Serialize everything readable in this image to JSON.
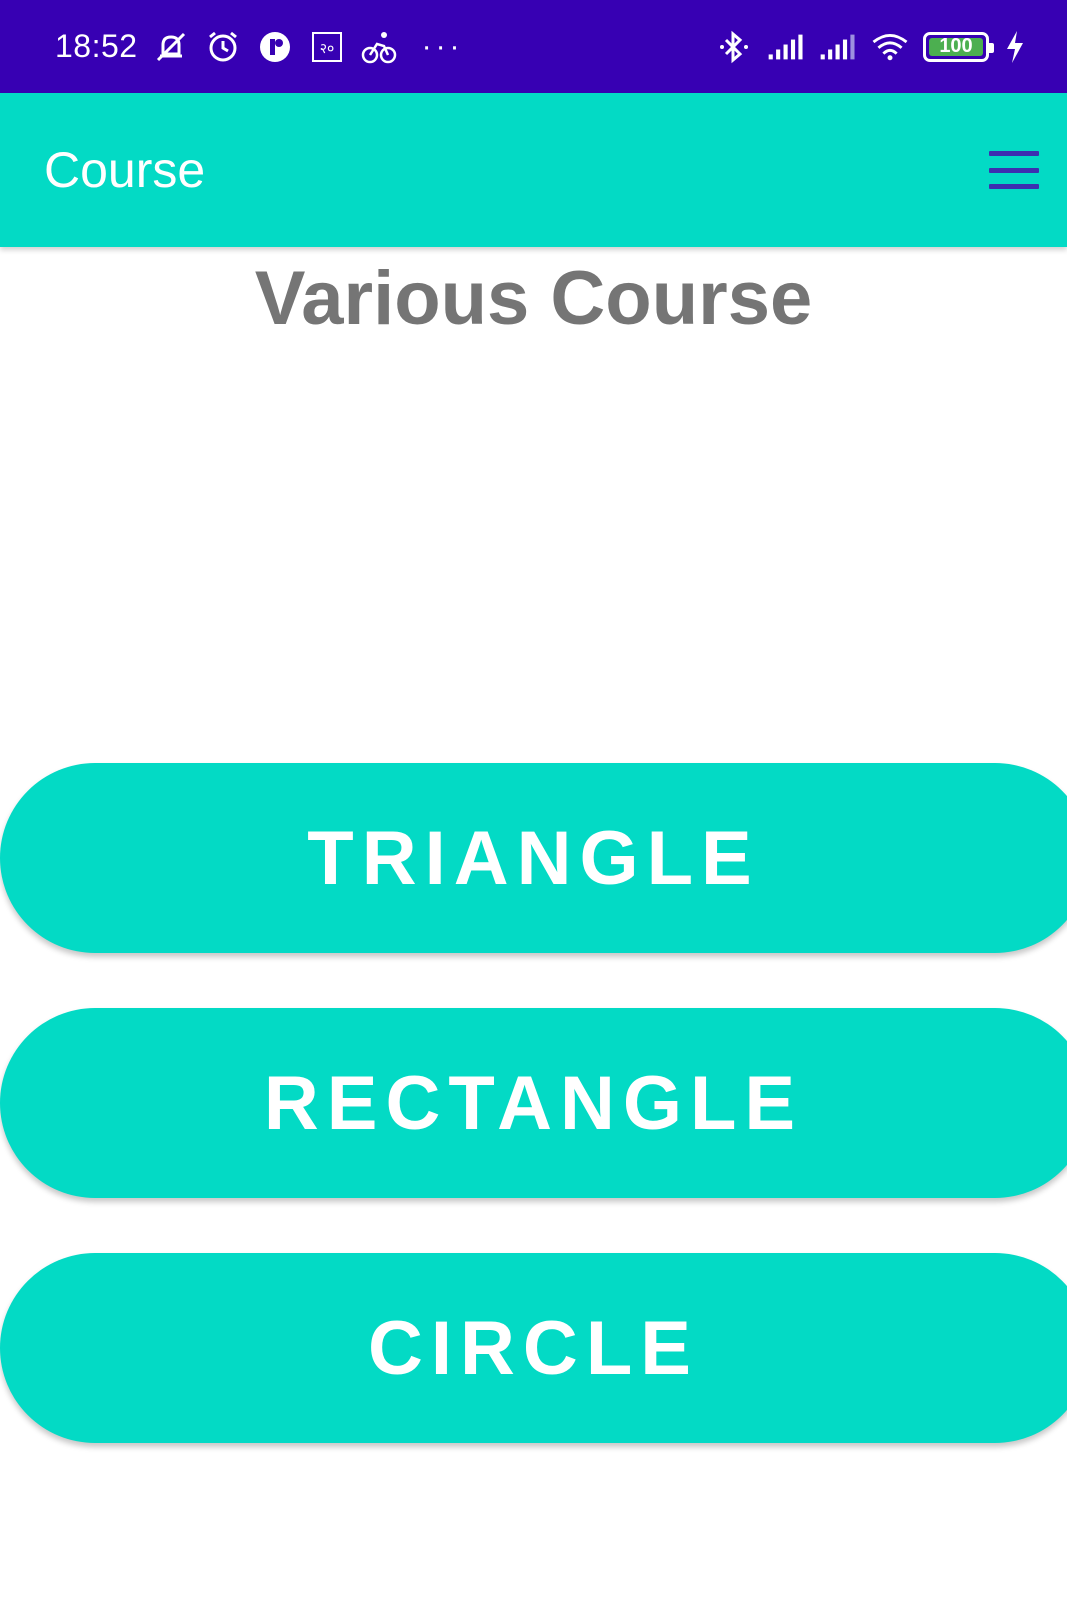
{
  "colors": {
    "status_bar": "#3700b3",
    "primary": "#03dac5",
    "heading_text": "#757575",
    "menu_icon": "#3d2fb0",
    "battery_fill": "#4caf50"
  },
  "status_bar": {
    "time": "18:52",
    "left_icons": [
      "muted-bell-icon",
      "alarm-icon",
      "app-notification-icon",
      "sim-icon",
      "cycling-icon"
    ],
    "more_indicator": "···",
    "right_icons": [
      "bluetooth-icon",
      "signal-icon",
      "signal-icon",
      "wifi-icon"
    ],
    "battery_level": "100"
  },
  "app_bar": {
    "title": "Course",
    "menu_icon": "hamburger-menu-icon"
  },
  "main": {
    "heading": "Various Course",
    "buttons": [
      {
        "label": "TRIANGLE"
      },
      {
        "label": "RECTANGLE"
      },
      {
        "label": "CIRCLE"
      }
    ]
  }
}
